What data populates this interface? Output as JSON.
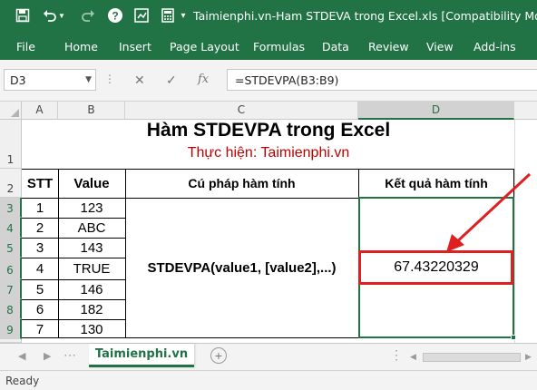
{
  "window": {
    "title": "Taimienphi.vn-Ham STDEVA trong Excel.xls  [Compatibility Mode]"
  },
  "ribbon": {
    "tabs": [
      "File",
      "Home",
      "Insert",
      "Page Layout",
      "Formulas",
      "Data",
      "Review",
      "View",
      "Add-ins"
    ]
  },
  "formula_bar": {
    "name_box": "D3",
    "fx_label": "fx",
    "formula": "=STDEVPA(B3:B9)"
  },
  "grid": {
    "columns": [
      "A",
      "B",
      "C",
      "D"
    ],
    "rows": [
      "1",
      "2",
      "3",
      "4",
      "5",
      "6",
      "7",
      "8",
      "9"
    ],
    "selected_column": "D",
    "selected_rows": [
      "3",
      "4",
      "5",
      "6",
      "7",
      "8",
      "9"
    ]
  },
  "sheet": {
    "title": "Hàm STDEVPA trong Excel",
    "subtitle": "Thực hiện: Taimienphi.vn",
    "headers": {
      "stt": "STT",
      "value": "Value",
      "syntax": "Cú pháp hàm tính",
      "result": "Kết quả hàm tính"
    },
    "stt": [
      "1",
      "2",
      "3",
      "4",
      "5",
      "6",
      "7"
    ],
    "values": [
      "123",
      "ABC",
      "143",
      "TRUE",
      "146",
      "182",
      "130"
    ],
    "syntax": "STDEVPA(value1, [value2],...)",
    "result": "67.43220329"
  },
  "tabs_bar": {
    "sheet_name": "Taimienphi.vn"
  },
  "status": {
    "text": "Ready"
  },
  "colors": {
    "excel_green": "#217346",
    "annotation_red": "#e02020",
    "subtitle_red": "#c00000"
  }
}
